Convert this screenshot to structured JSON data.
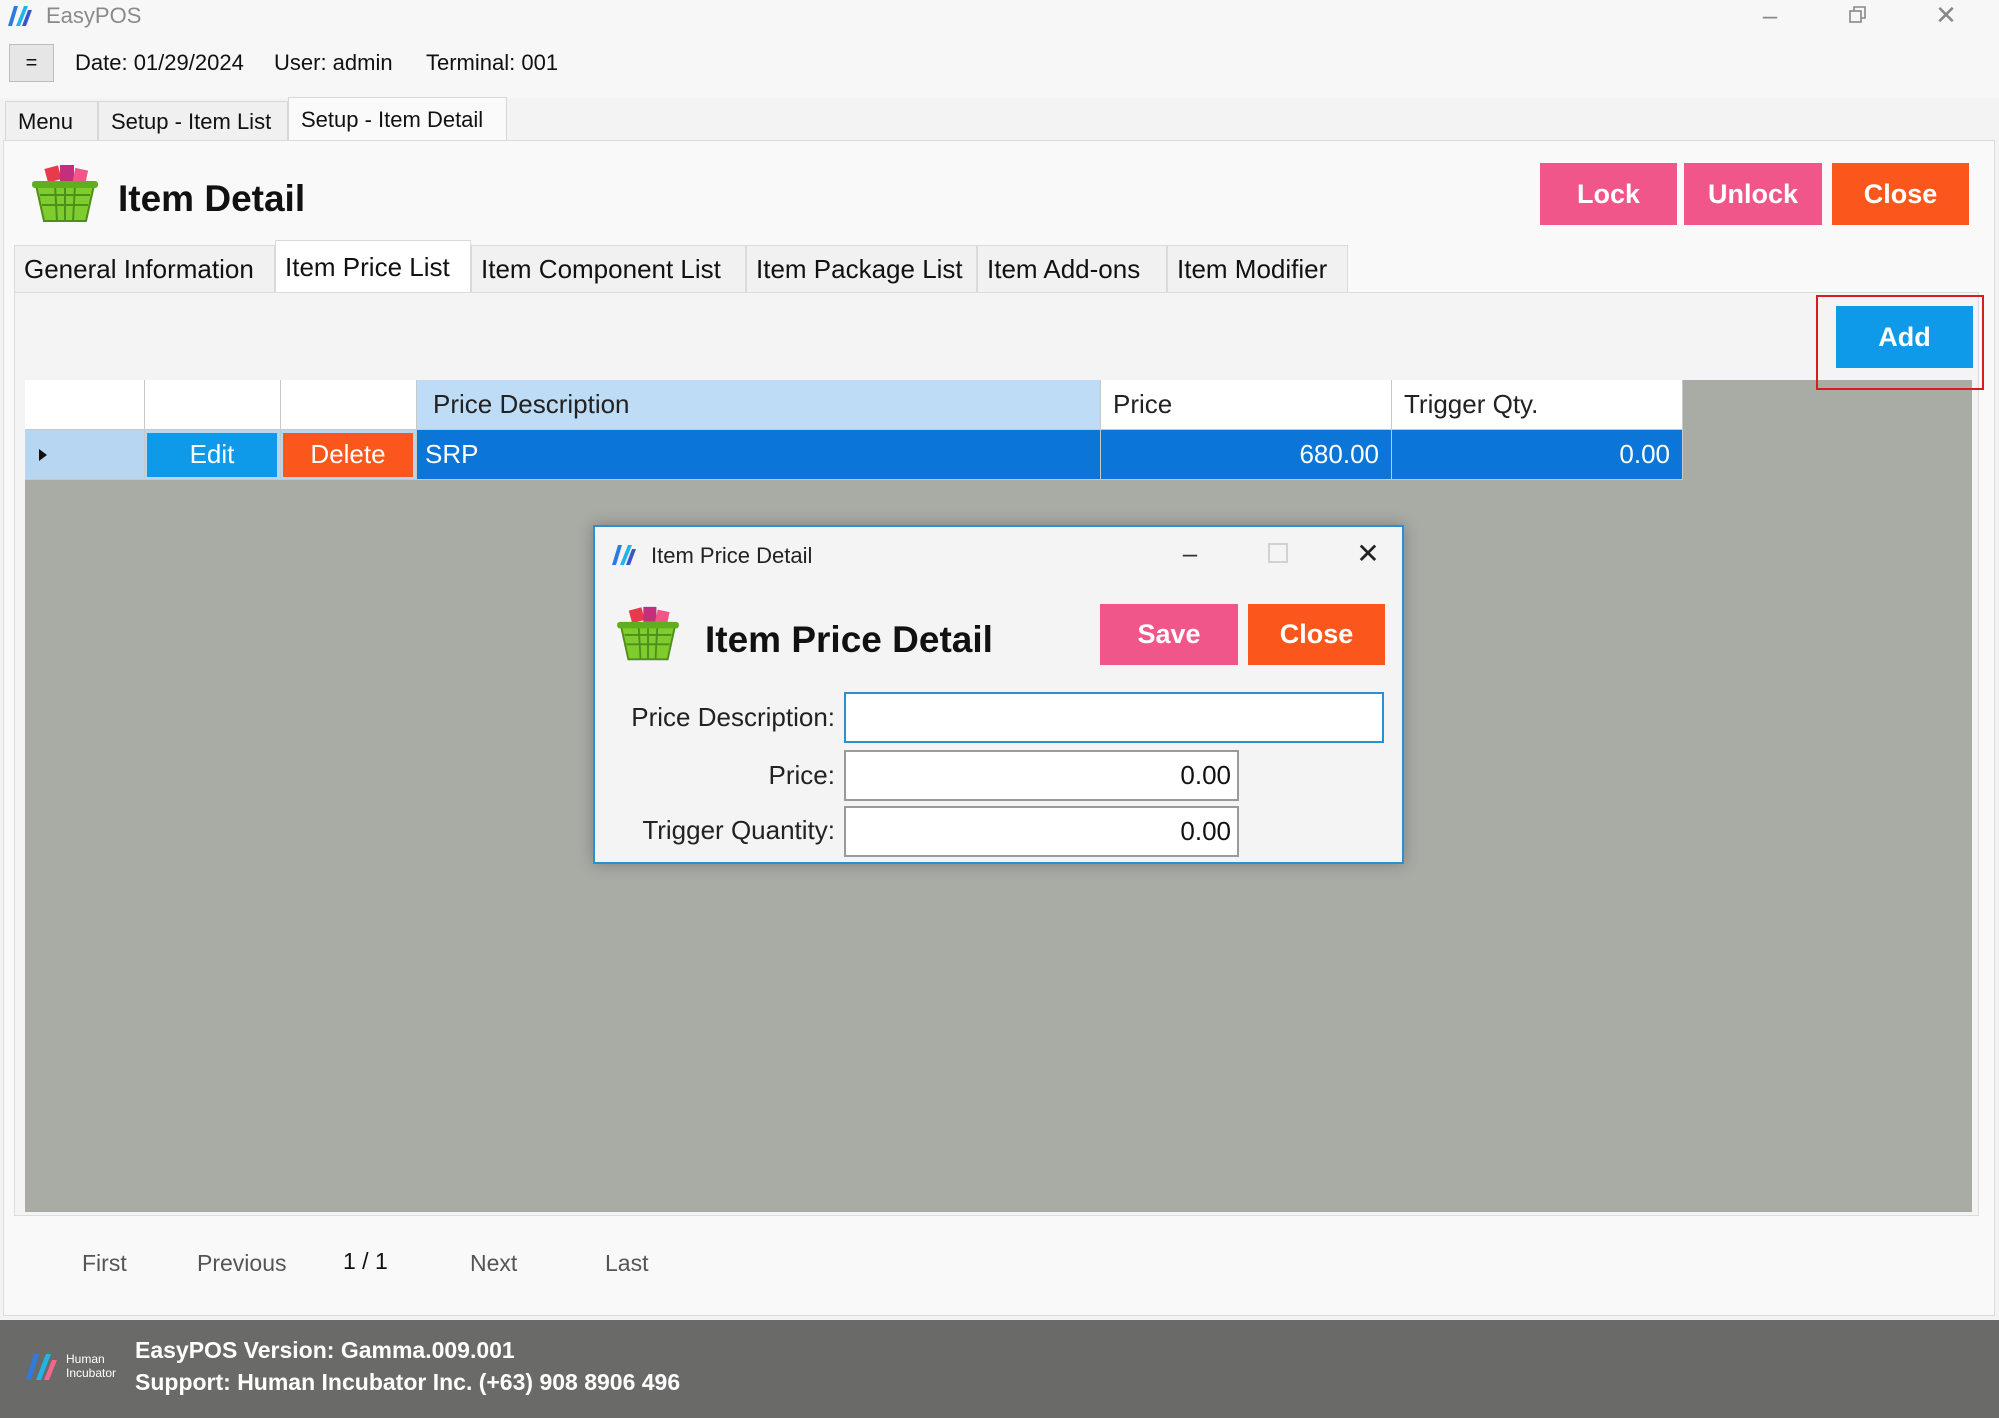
{
  "window": {
    "title": "EasyPOS",
    "controls": [
      "minimize-icon",
      "restore-icon",
      "close-icon"
    ]
  },
  "infobar": {
    "menu_glyph": "=",
    "date": "Date: 01/29/2024",
    "user": "User: admin",
    "terminal": "Terminal: 001"
  },
  "main_tabs": [
    {
      "label": "Menu",
      "active": false
    },
    {
      "label": "Setup - Item List",
      "active": false
    },
    {
      "label": "Setup - Item Detail",
      "active": true
    }
  ],
  "page": {
    "title": "Item Detail",
    "buttons": {
      "lock": "Lock",
      "unlock": "Unlock",
      "close": "Close"
    }
  },
  "sub_tabs": [
    {
      "label": "General Information",
      "active": false
    },
    {
      "label": "Item Price List",
      "active": true
    },
    {
      "label": "Item Component List",
      "active": false
    },
    {
      "label": "Item Package List",
      "active": false
    },
    {
      "label": "Item Add-ons",
      "active": false
    },
    {
      "label": "Item Modifier",
      "active": false
    }
  ],
  "add_button": "Add",
  "grid": {
    "columns": [
      "",
      "",
      "",
      "Price Description",
      "Price",
      "Trigger Qty."
    ],
    "rows": [
      {
        "edit": "Edit",
        "delete": "Delete",
        "description": "SRP",
        "price": "680.00",
        "trigger_qty": "0.00"
      }
    ]
  },
  "pager": {
    "first": "First",
    "previous": "Previous",
    "page": "1 / 1",
    "next": "Next",
    "last": "Last"
  },
  "status": {
    "logo_text_line1": "Human",
    "logo_text_line2": "Incubator",
    "version": "EasyPOS Version: Gamma.009.001",
    "support": "Support: Human Incubator Inc. (+63) 908 8906 496"
  },
  "dialog": {
    "window_title": "Item Price Detail",
    "title": "Item Price Detail",
    "buttons": {
      "save": "Save",
      "close": "Close"
    },
    "fields": {
      "price_description": {
        "label": "Price Description:",
        "value": ""
      },
      "price": {
        "label": "Price:",
        "value": "0.00"
      },
      "trigger_quantity": {
        "label": "Trigger Quantity:",
        "value": "0.00"
      }
    }
  },
  "colors": {
    "pink": "#f0568a",
    "orange": "#fb571c",
    "blue": "#0e9ae8",
    "row_selected": "#0b75d8",
    "grid_background": "#a9aba5",
    "status_bar": "#6a6b69"
  }
}
